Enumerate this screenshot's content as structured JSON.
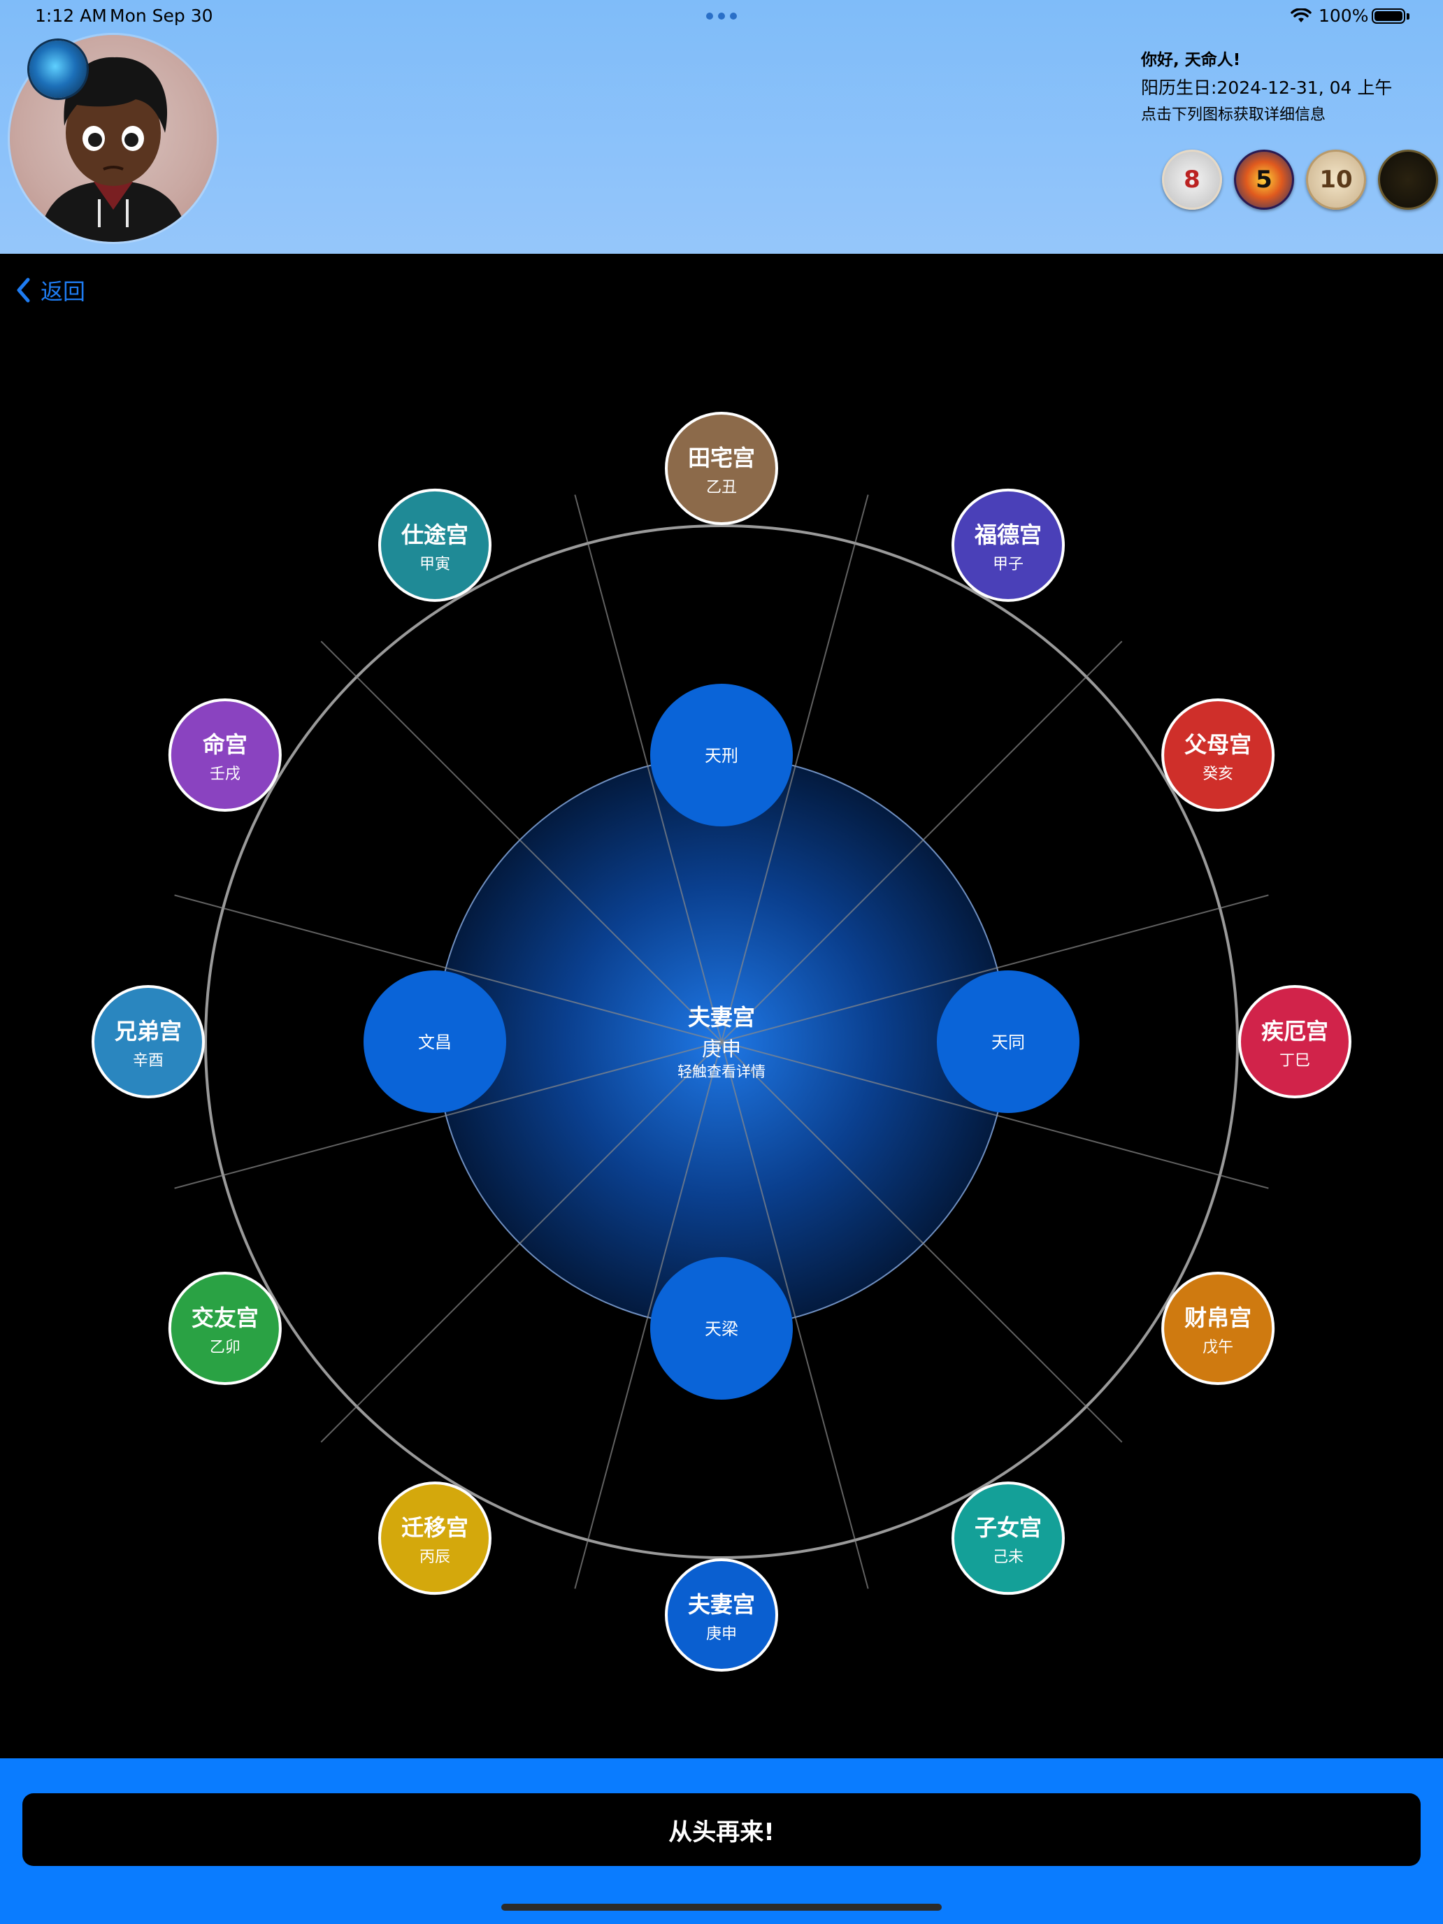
{
  "status": {
    "time": "1:12 AM",
    "date": "Mon Sep 30",
    "battery": "100%"
  },
  "header": {
    "greeting": "你好, 天命人!",
    "birthday": "阳历生日:2024-12-31, 04 上午",
    "hint": "点击下列图标获取详细信息",
    "badges": [
      "8",
      "5",
      "10",
      ""
    ]
  },
  "nav": {
    "back": "返回"
  },
  "center": {
    "title": "夫妻宫",
    "ganzhi": "庚申",
    "hint": "轻触查看详情"
  },
  "stars": [
    {
      "name": "天刑",
      "position": "top"
    },
    {
      "name": "天同",
      "position": "right"
    },
    {
      "name": "天梁",
      "position": "bottom"
    },
    {
      "name": "文昌",
      "position": "left"
    }
  ],
  "palaces": [
    {
      "name": "田宅宫",
      "ganzhi": "乙丑",
      "color": "#8c6a4a"
    },
    {
      "name": "福德宫",
      "ganzhi": "甲子",
      "color": "#4a40b8"
    },
    {
      "name": "父母宫",
      "ganzhi": "癸亥",
      "color": "#cf2f2a"
    },
    {
      "name": "疾厄宫",
      "ganzhi": "丁巳",
      "color": "#d1234a"
    },
    {
      "name": "财帛宫",
      "ganzhi": "戊午",
      "color": "#cf7a10"
    },
    {
      "name": "子女宫",
      "ganzhi": "己未",
      "color": "#14a098"
    },
    {
      "name": "夫妻宫",
      "ganzhi": "庚申",
      "color": "#0a5fd0"
    },
    {
      "name": "迁移宫",
      "ganzhi": "丙辰",
      "color": "#d4a80c"
    },
    {
      "name": "交友宫",
      "ganzhi": "乙卯",
      "color": "#2aa244"
    },
    {
      "name": "兄弟宫",
      "ganzhi": "辛酉",
      "color": "#2a86bf"
    },
    {
      "name": "命宫",
      "ganzhi": "壬戌",
      "color": "#8a43c0"
    },
    {
      "name": "仕途宫",
      "ganzhi": "甲寅",
      "color": "#1f8a96"
    }
  ],
  "colors": {
    "accent": "#0a7cff",
    "star": "#0a64d8",
    "back": "#1e7cf2"
  },
  "footer": {
    "restart": "从头再来!"
  }
}
